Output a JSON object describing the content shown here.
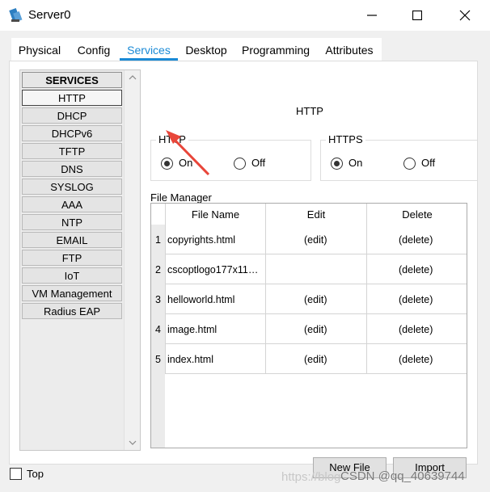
{
  "window": {
    "title": "Server0",
    "icon": "server-app-icon",
    "controls": [
      "minimize-icon",
      "maximize-icon",
      "close-icon"
    ]
  },
  "tabs": [
    {
      "label": "Physical",
      "active": false
    },
    {
      "label": "Config",
      "active": false
    },
    {
      "label": "Services",
      "active": true
    },
    {
      "label": "Desktop",
      "active": false
    },
    {
      "label": "Programming",
      "active": false
    },
    {
      "label": "Attributes",
      "active": false
    }
  ],
  "services": {
    "header": "SERVICES",
    "items": [
      {
        "label": "HTTP",
        "selected": true
      },
      {
        "label": "DHCP"
      },
      {
        "label": "DHCPv6"
      },
      {
        "label": "TFTP"
      },
      {
        "label": "DNS"
      },
      {
        "label": "SYSLOG"
      },
      {
        "label": "AAA"
      },
      {
        "label": "NTP"
      },
      {
        "label": "EMAIL"
      },
      {
        "label": "FTP"
      },
      {
        "label": "IoT"
      },
      {
        "label": "VM Management"
      },
      {
        "label": "Radius EAP"
      }
    ]
  },
  "http_panel": {
    "title": "HTTP",
    "http_group": {
      "legend": "HTTP",
      "on_label": "On",
      "off_label": "Off",
      "selected": "On"
    },
    "https_group": {
      "legend": "HTTPS",
      "on_label": "On",
      "off_label": "Off",
      "selected": "On"
    },
    "file_manager": {
      "label": "File Manager",
      "columns": [
        "File Name",
        "Edit",
        "Delete"
      ],
      "rows": [
        {
          "num": "1",
          "name": "copyrights.html",
          "edit": "(edit)",
          "delete": "(delete)"
        },
        {
          "num": "2",
          "name": "cscoptlogo177x11…",
          "edit": "",
          "delete": "(delete)"
        },
        {
          "num": "3",
          "name": "helloworld.html",
          "edit": "(edit)",
          "delete": "(delete)"
        },
        {
          "num": "4",
          "name": "image.html",
          "edit": "(edit)",
          "delete": "(delete)"
        },
        {
          "num": "5",
          "name": "index.html",
          "edit": "(edit)",
          "delete": "(delete)"
        }
      ]
    },
    "buttons": {
      "new_file": "New File",
      "import": "Import"
    }
  },
  "footer": {
    "top_label": "Top",
    "top_checked": false
  },
  "watermark": {
    "faint": "https://blog",
    "text": "CSDN @qq_40639744"
  },
  "colors": {
    "accent": "#1a8ad6",
    "annotation_arrow": "#e8463a"
  }
}
